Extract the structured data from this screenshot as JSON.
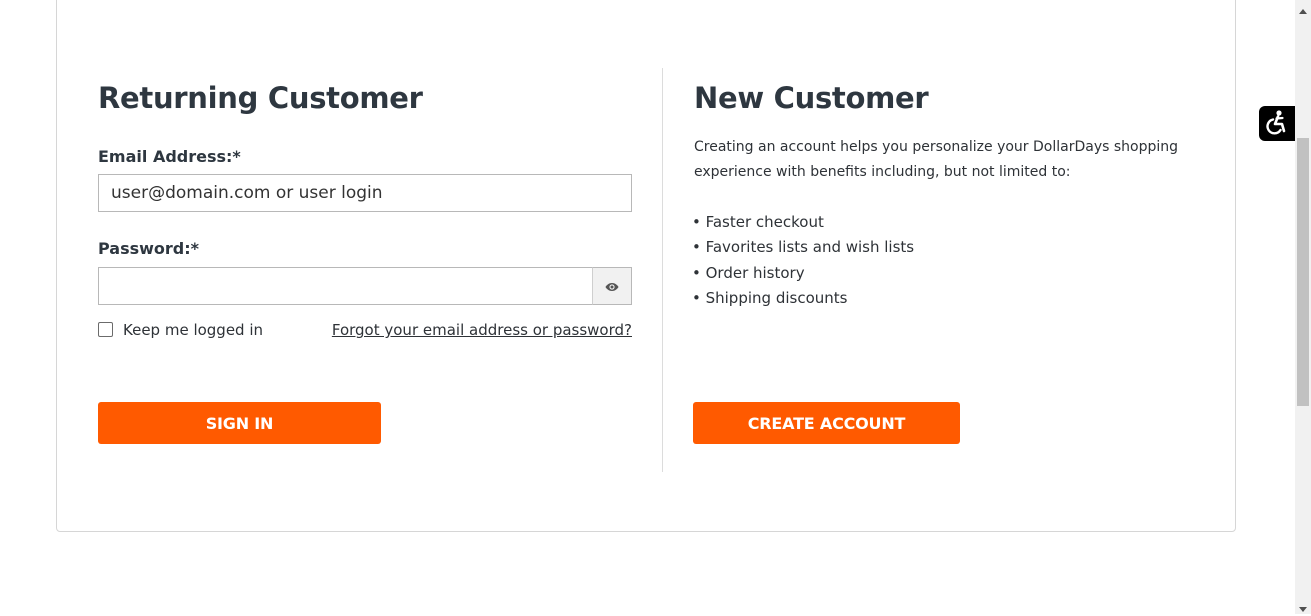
{
  "returning": {
    "heading": "Returning Customer",
    "email_label": "Email Address:*",
    "email_placeholder": "user@domain.com or user login",
    "password_label": "Password:*",
    "keep_logged_in": "Keep me logged in",
    "forgot_link": "Forgot your email address or password?",
    "sign_in_button": "SIGN IN"
  },
  "new_customer": {
    "heading": "New Customer",
    "description": "Creating an account helps you personalize your DollarDays shopping experience with benefits including, but not limited to:",
    "benefits": [
      "• Faster checkout",
      "• Favorites lists and wish lists",
      "• Order history",
      "• Shipping discounts"
    ],
    "create_account_button": "CREATE ACCOUNT"
  },
  "icons": {
    "password_toggle": "eye-icon",
    "accessibility": "accessibility-icon"
  },
  "colors": {
    "accent": "#ff5a00",
    "alert_background": "#f4dede",
    "heading": "#2e3740"
  }
}
